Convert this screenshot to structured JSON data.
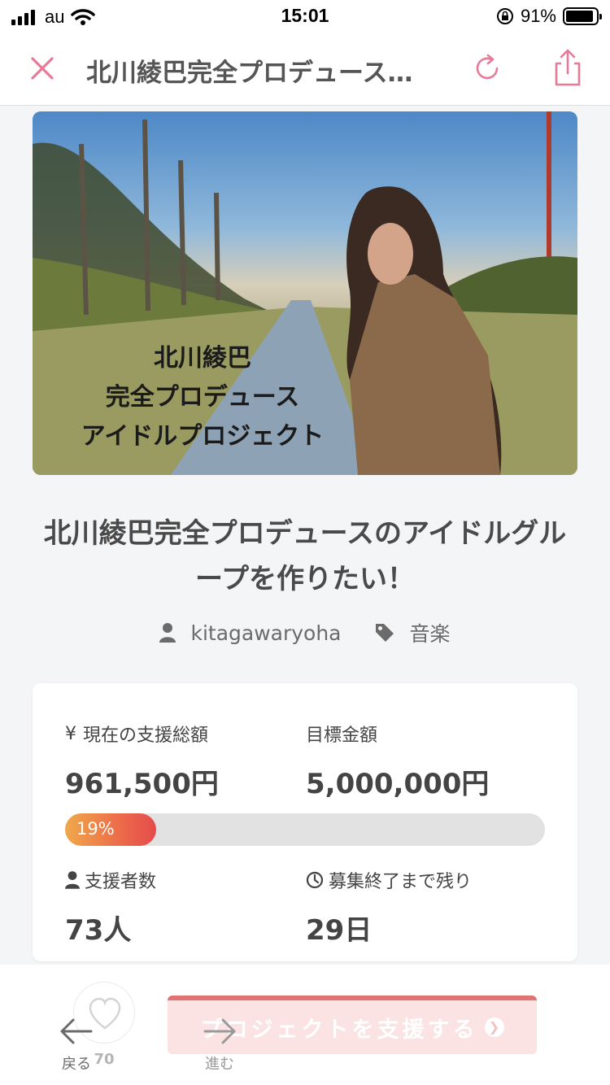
{
  "status_bar": {
    "carrier": "au",
    "time": "15:01",
    "battery_percent": "91%"
  },
  "nav": {
    "title": "北川綾巴完全プロデュース…",
    "icons": [
      "close-icon",
      "reload-icon",
      "share-icon"
    ],
    "accent_color": "#e87a98"
  },
  "hero": {
    "caption_lines": [
      "北川綾巴",
      "完全プロデュース",
      "アイドルプロジェクト"
    ]
  },
  "project": {
    "title": "北川綾巴完全プロデュースのアイドルグループを作りたい！",
    "owner": "kitagawaryoha",
    "category": "音楽"
  },
  "stats": {
    "current_label": "現在の支援総額",
    "current_symbol": "¥",
    "current_value": "961,500円",
    "goal_label": "目標金額",
    "goal_value": "5,000,000円",
    "progress_percent": 19,
    "progress_text": "19%",
    "supporters_label": "支援者数",
    "supporters_value": "73人",
    "remaining_label": "募集終了まで残り",
    "remaining_value": "29日"
  },
  "actions": {
    "like_count": "70",
    "support_button": "プロジェクトを支援する"
  },
  "toolbar": {
    "back": "戻る",
    "forward": "進む"
  }
}
